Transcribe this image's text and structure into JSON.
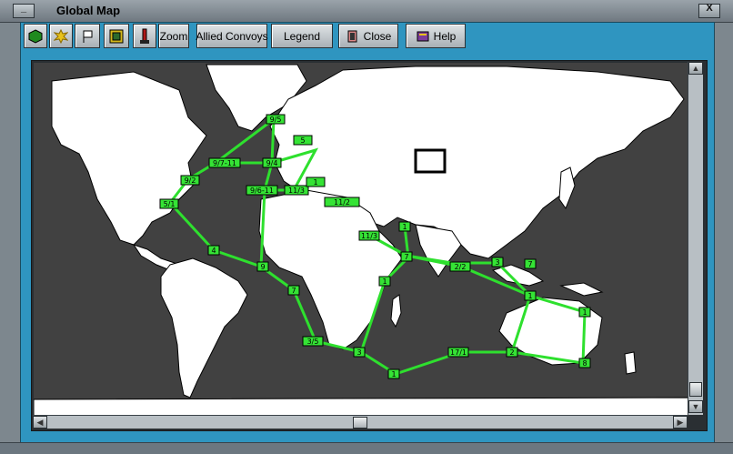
{
  "window": {
    "title": "Global Map",
    "minimize_glyph": "_",
    "close_glyph": "X"
  },
  "toolbar": {
    "icon_buttons": [
      {
        "name": "hex-icon",
        "color": "#1f8a1f"
      },
      {
        "name": "explosion-icon",
        "color": "#e8c21a"
      },
      {
        "name": "flag-icon",
        "color": "#ffffff"
      },
      {
        "name": "grid-icon",
        "color": "#d4b81c"
      },
      {
        "name": "marker-icon",
        "color": "#b01818"
      }
    ],
    "zoom_label": "Zoom",
    "allied_convoys_label": "Allied Convoys",
    "legend_label": "Legend",
    "close_label": "Close",
    "help_label": "Help"
  },
  "map": {
    "ocean_color": "#414141",
    "land_color": "#ffffff",
    "route_color": "#2ee02e",
    "nodes": [
      {
        "id": "n1",
        "label": "9/5"
      },
      {
        "id": "n2",
        "label": "9/7-11"
      },
      {
        "id": "n3",
        "label": "9/4"
      },
      {
        "id": "n4",
        "label": "9/2"
      },
      {
        "id": "n5",
        "label": "5/1"
      },
      {
        "id": "n6",
        "label": "9/6-11"
      },
      {
        "id": "n7",
        "label": "11/3"
      },
      {
        "id": "n8",
        "label": "4"
      },
      {
        "id": "n9",
        "label": "9"
      },
      {
        "id": "n10",
        "label": "7"
      },
      {
        "id": "n11",
        "label": "3/5"
      },
      {
        "id": "n12",
        "label": "3"
      },
      {
        "id": "n13",
        "label": "1"
      },
      {
        "id": "n14",
        "label": "17/1"
      },
      {
        "id": "n15",
        "label": "2"
      },
      {
        "id": "n16",
        "label": "8"
      },
      {
        "id": "n17",
        "label": "1"
      },
      {
        "id": "n18",
        "label": "1"
      },
      {
        "id": "n19",
        "label": "2/2"
      },
      {
        "id": "n20",
        "label": "3"
      },
      {
        "id": "n21",
        "label": "7"
      },
      {
        "id": "n22",
        "label": "1"
      },
      {
        "id": "n23",
        "label": "11/3"
      },
      {
        "id": "n24",
        "label": "1"
      },
      {
        "id": "n25",
        "label": "1"
      },
      {
        "id": "n26",
        "label": "11/2"
      },
      {
        "id": "n27",
        "label": "5"
      },
      {
        "id": "n28",
        "label": "7"
      }
    ]
  }
}
